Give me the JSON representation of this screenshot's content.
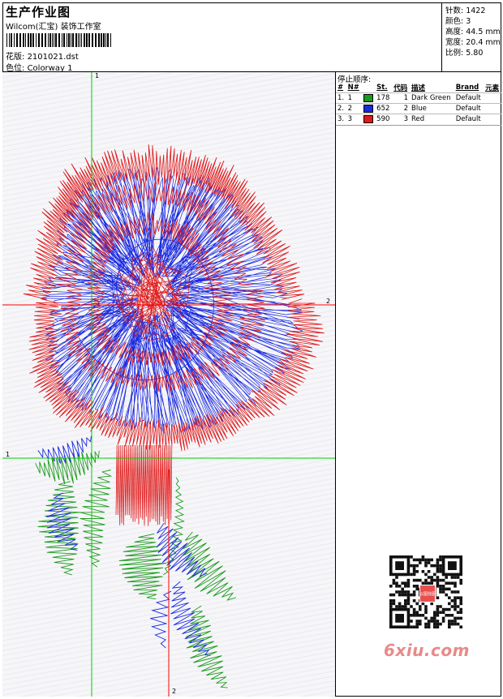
{
  "header": {
    "title": "生产作业图",
    "company": "Wilcom(汇宝) 装饰工作室",
    "design_label": "花版:",
    "design_value": "2101021.dst",
    "colorway_label": "色位:",
    "colorway_value": "Colorway 1"
  },
  "stats": {
    "stitches": "针数: 1422",
    "colors": "颜色: 3",
    "height": "高度: 44.5 mm",
    "width": "宽度: 20.4 mm",
    "scale": "比例: 5.80"
  },
  "stop_sequence": {
    "title": "停止顺序:",
    "columns": [
      "#",
      "N#",
      "St.",
      "代码",
      "描述",
      "Brand",
      "元素"
    ],
    "rows": [
      {
        "num": "1.",
        "n": "1",
        "color": "#1a9a1a",
        "st": "178",
        "code": "1",
        "desc": "Dark Green",
        "brand": "Default"
      },
      {
        "num": "2.",
        "n": "2",
        "color": "#1a2ae0",
        "st": "652",
        "code": "2",
        "desc": "Blue",
        "brand": "Default"
      },
      {
        "num": "3.",
        "n": "3",
        "color": "#e01818",
        "st": "590",
        "code": "3",
        "desc": "Red",
        "brand": "Default"
      }
    ]
  },
  "canvas": {
    "guide_labels": {
      "v1": "1",
      "h2": "2",
      "h1": "1",
      "v2": "2"
    }
  },
  "watermark": {
    "text": "6xiu.com",
    "qr_label": "以图找图"
  }
}
